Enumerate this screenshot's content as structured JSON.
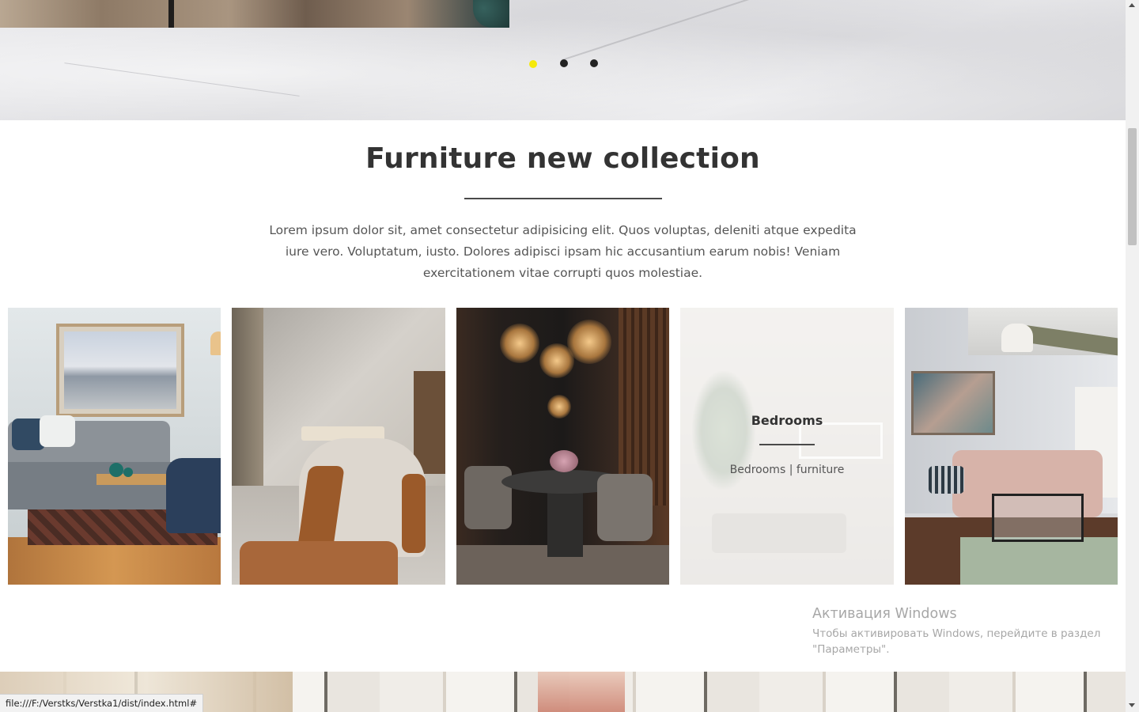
{
  "slider": {
    "dots": [
      {
        "label": "slide-1",
        "active": true
      },
      {
        "label": "slide-2",
        "active": false
      },
      {
        "label": "slide-3",
        "active": false
      }
    ],
    "accent_color": "#f5e90a"
  },
  "collection": {
    "title": "Furniture new collection",
    "description": "Lorem ipsum dolor sit, amet consectetur adipisicing elit. Quos voluptas, deleniti atque expedita iure vero. Voluptatum, iusto. Dolores adipisci ipsam hic accusantium earum nobis! Veniam exercitationem vitae corrupti quos molestiae.",
    "cards": [
      {
        "name": "living-room"
      },
      {
        "name": "armchair"
      },
      {
        "name": "dining-room"
      },
      {
        "name": "bedrooms",
        "hover_title": "Bedrooms",
        "hover_subtitle": "Bedrooms | furniture"
      },
      {
        "name": "sofa-living-room"
      }
    ]
  },
  "watermark": {
    "title": "Активация Windows",
    "subtitle": "Чтобы активировать Windows, перейдите в раздел \"Параметры\"."
  },
  "statusbar": {
    "url": "file:///F:/Verstks/Verstka1/dist/index.html#"
  }
}
